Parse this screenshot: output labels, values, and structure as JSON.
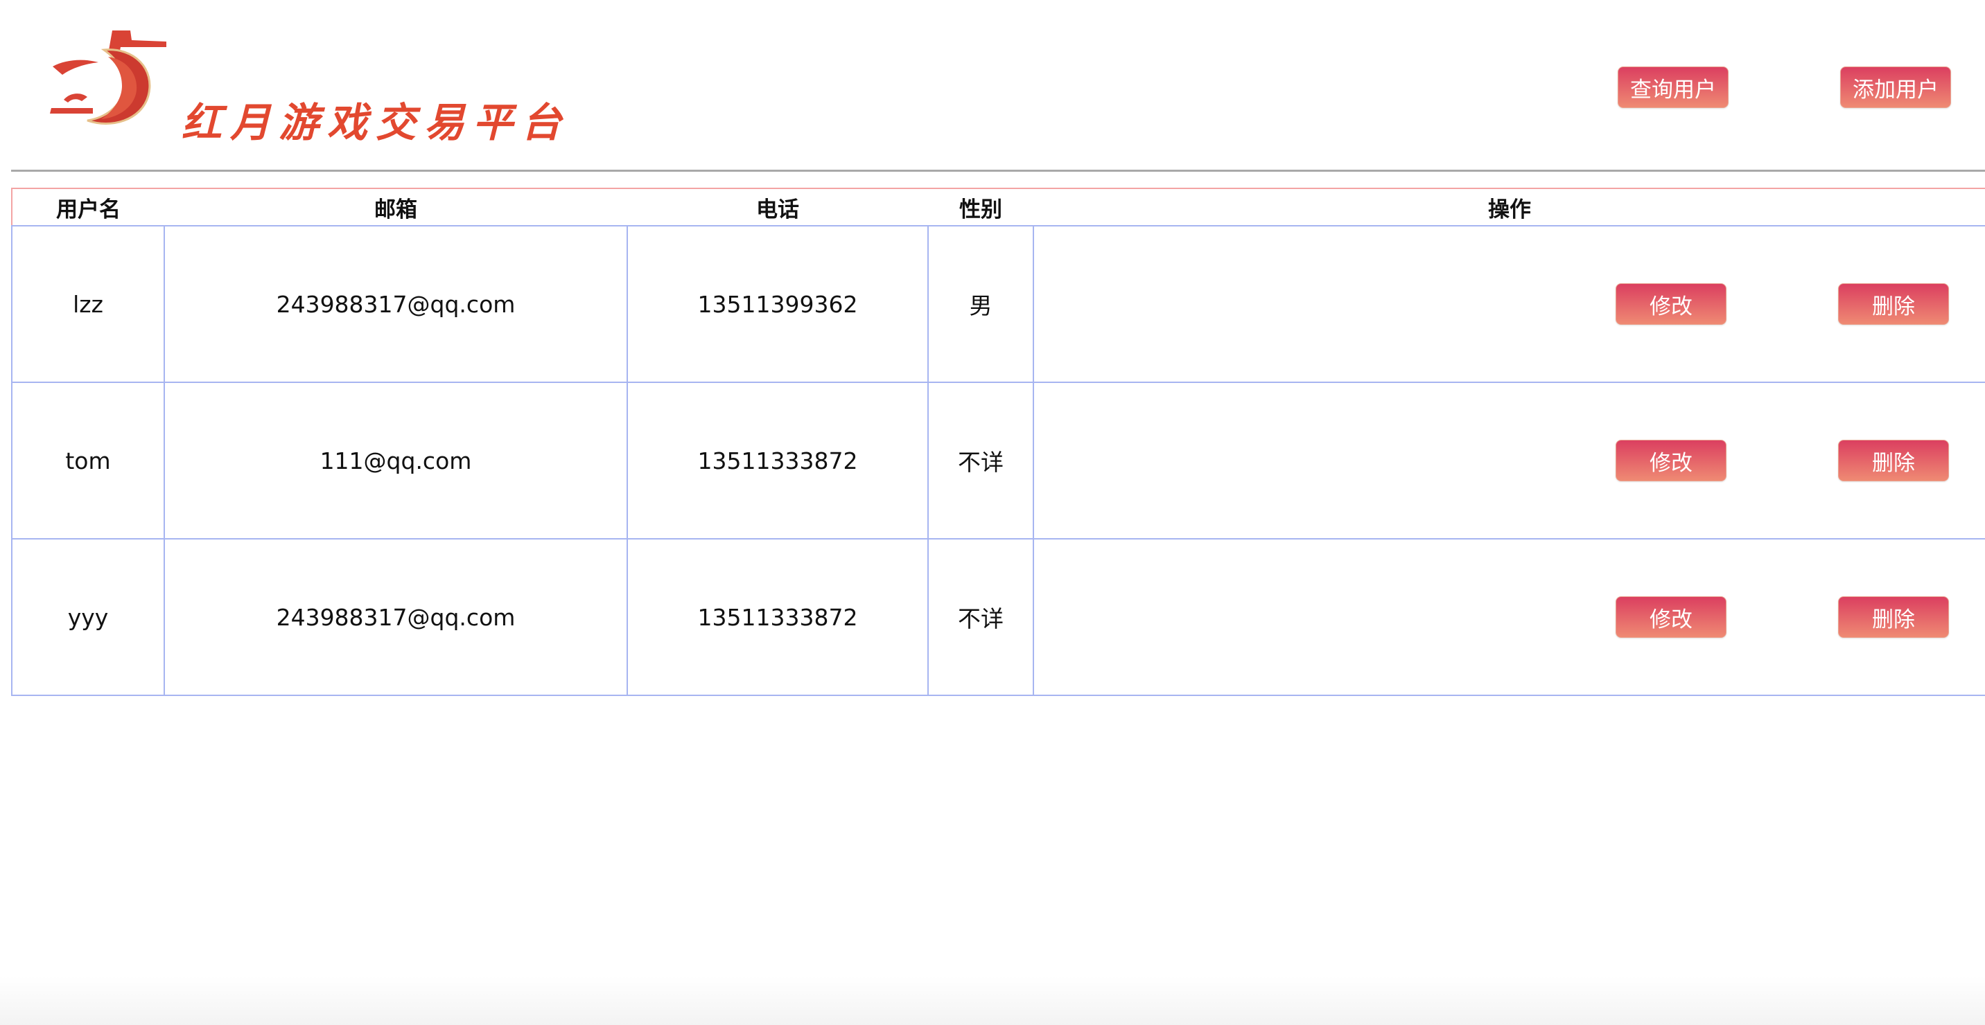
{
  "brand": {
    "title": "红月游戏交易平台",
    "logo_icon": "red-moon-logo-icon",
    "accent_color": "#e2482f"
  },
  "header": {
    "query_label": "查询用户",
    "add_label": "添加用户"
  },
  "table": {
    "columns": [
      "用户名",
      "邮箱",
      "电话",
      "性别",
      "操作"
    ],
    "rows": [
      {
        "username": "lzz",
        "email": "243988317@qq.com",
        "phone": "13511399362",
        "gender": "男",
        "edit_label": "修改",
        "delete_label": "删除"
      },
      {
        "username": "tom",
        "email": "111@qq.com",
        "phone": "13511333872",
        "gender": "不详",
        "edit_label": "修改",
        "delete_label": "删除"
      },
      {
        "username": "yyy",
        "email": "243988317@qq.com",
        "phone": "13511333872",
        "gender": "不详",
        "edit_label": "修改",
        "delete_label": "删除"
      }
    ]
  },
  "colors": {
    "button_gradient_top": "#db3f60",
    "button_gradient_bottom": "#ef8a73",
    "table_border": "#a7b5f1",
    "header_top_border": "#f3a4a4",
    "divider": "#a9a9a9"
  }
}
